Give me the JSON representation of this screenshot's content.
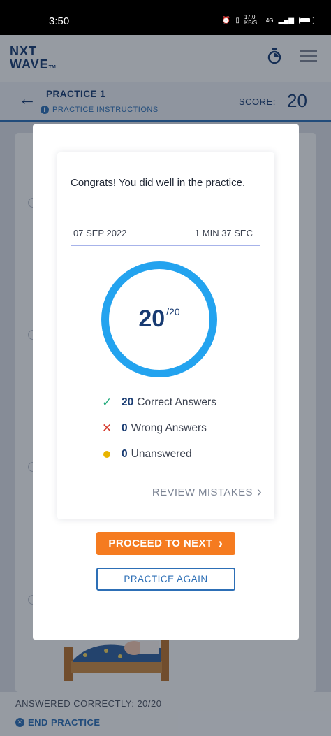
{
  "status_bar": {
    "time": "3:50",
    "net_speed": "17.0 KB/S",
    "network": "4G"
  },
  "app": {
    "logo_top": "NXT",
    "logo_bottom": "WAVE",
    "logo_tm": "TM"
  },
  "practice_header": {
    "title": "PRACTICE 1",
    "instructions_link": "PRACTICE INSTRUCTIONS",
    "score_label": "SCORE:",
    "score_value": "20"
  },
  "footer": {
    "answered_correctly": "ANSWERED CORRECTLY: 20/20",
    "end_practice": "END PRACTICE"
  },
  "result_modal": {
    "message": "Congrats! You did well in the practice.",
    "date": "07 SEP 2022",
    "duration": "1 MIN 37 SEC",
    "score": "20",
    "score_total": "/20",
    "correct_count": "20",
    "correct_label": "Correct Answers",
    "wrong_count": "0",
    "wrong_label": "Wrong Answers",
    "unanswered_count": "0",
    "unanswered_label": "Unanswered",
    "review_mistakes": "REVIEW MISTAKES",
    "proceed_button": "PROCEED TO NEXT",
    "practice_again_button": "PRACTICE AGAIN"
  },
  "colors": {
    "primary_blue": "#2d6fb6",
    "navy": "#183b72",
    "ring_blue": "#23a3ef",
    "orange": "#f57b20",
    "correct_green": "#1fa97a",
    "wrong_red": "#d63a2c",
    "unanswered_yellow": "#e8b400"
  }
}
